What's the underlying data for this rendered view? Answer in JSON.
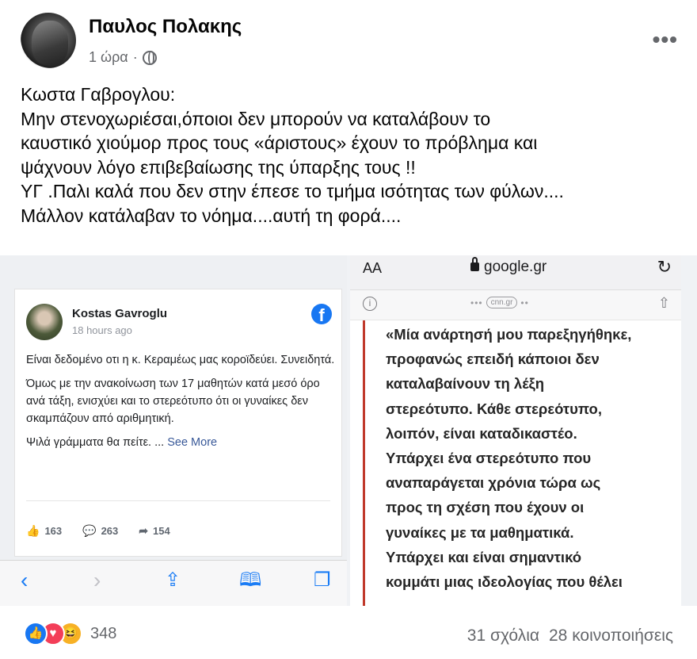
{
  "post": {
    "author": "Παυλος Πολακης",
    "time": "1 ώρα",
    "separator": "·",
    "privacy_icon": "globe-icon",
    "more_icon": "more-horizontal-icon",
    "more_label": "•••",
    "text_lines": [
      "Κωστα Γαβρογλου:",
      "Μην στενοχωριέσαι,όποιοι δεν μπορούν να καταλάβουν το",
      "καυστικό χιούμορ προς τους «άριστους» έχουν το πρόβλημα και",
      "ψάχνουν λόγο επιβεβαίωσης της ύπαρξης τους !!",
      "ΥΓ .Παλι καλά που δεν στην έπεσε το τμήμα ισότητας  των φύλων....",
      "Μάλλον κατάλαβαν το νόημα....αυτή τη φορά...."
    ]
  },
  "left_screenshot": {
    "name": "Kostas Gavroglu",
    "time": "18 hours ago",
    "fb_logo": "f",
    "paragraphs": [
      "Είναι δεδομένο οτι η κ. Κεραμέως μας κοροϊδεύει. Συνειδητά.",
      "Όμως με την ανακοίνωση των 17 μαθητών κατά μεσό όρο ανά τάξη, ενισχύει και το στερεότυπο ότι οι γυναίκες δεν σκαμπάζουν από αριθμητική."
    ],
    "last_text": "Ψιλά γράμματα θα πείτε. ... ",
    "see_more": "See More",
    "likes": "163",
    "comments": "263",
    "shares": "154",
    "nav": {
      "back": "‹",
      "forward": "›",
      "share": "⇪",
      "bookmarks": "🕮",
      "tabs": "❐"
    }
  },
  "right_screenshot": {
    "aa": "AA",
    "url": "google.gr",
    "reload": "↻",
    "info": "i",
    "site": "cnn.gr",
    "dots": "•••",
    "dots_after": "••",
    "share": "⇧",
    "lines": [
      "«Μία ανάρτησή μου παρεξηγήθηκε,",
      "προφανώς επειδή κάποιοι δεν",
      "καταλαβαίνουν τη λέξη",
      "στερεότυπο. Κάθε στερεότυπο,",
      "λοιπόν, είναι καταδικαστέο.",
      "Υπάρχει ένα στερεότυπο που",
      "αναπαράγεται χρόνια τώρα ως",
      "προς τη σχέση που έχουν οι",
      "γυναίκες με τα μαθηματικά.",
      "Υπάρχει και είναι σημαντικό",
      "κομμάτι μιας ιδεολογίας που θέλει"
    ]
  },
  "footer": {
    "reaction_icons": [
      "like-icon",
      "love-icon",
      "haha-icon"
    ],
    "reaction_count": "348",
    "comments": "31 σχόλια",
    "shares": "28 κοινοποιήσεις"
  }
}
